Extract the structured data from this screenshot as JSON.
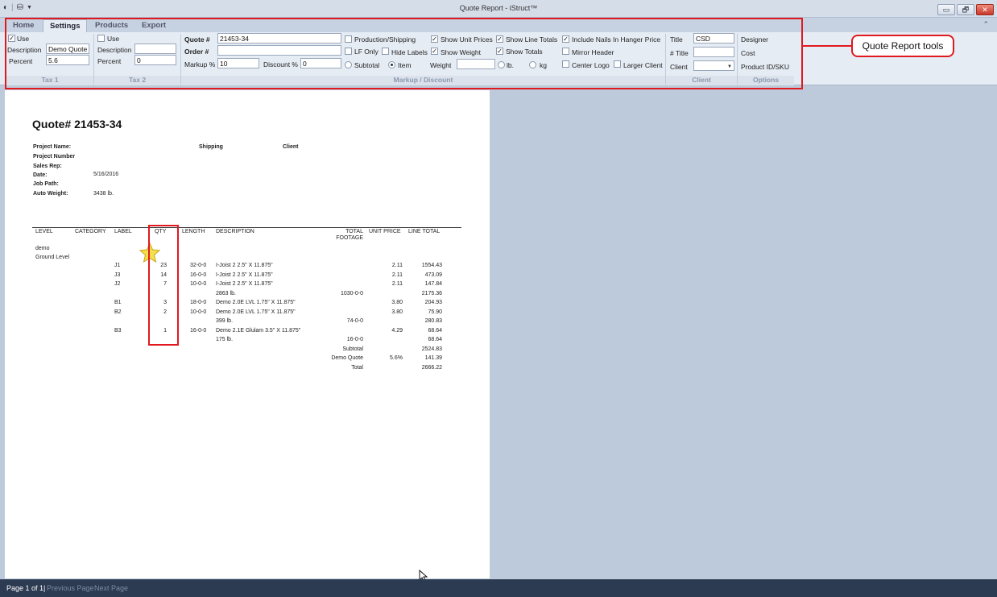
{
  "window": {
    "title": "Quote Report - iStruct™",
    "minimize": "▭",
    "restore": "🗗",
    "close": "✕"
  },
  "ribbon_tabs": [
    "Home",
    "Settings",
    "Products",
    "Export"
  ],
  "tax1": {
    "use_checked": true,
    "use_label": "Use",
    "description_label": "Description",
    "description_value": "Demo Quote",
    "percent_label": "Percent",
    "percent_value": "5.6",
    "group": "Tax 1"
  },
  "tax2": {
    "use_checked": false,
    "use_label": "Use",
    "description_label": "Description",
    "description_value": "",
    "percent_label": "Percent",
    "percent_value": "0",
    "group": "Tax 2"
  },
  "markup": {
    "quote_label": "Quote #",
    "quote_value": "21453-34",
    "order_label": "Order #",
    "order_value": "",
    "markup_label": "Markup %",
    "markup_value": "10",
    "discount_label": "Discount %",
    "discount_value": "0",
    "production_shipping": "Production/Shipping",
    "lf_only": "LF Only",
    "hide_labels": "Hide Labels",
    "subtotal": "Subtotal",
    "item": "Item",
    "weight_label": "Weight",
    "lb": "lb.",
    "kg": "kg",
    "show_unit_prices": "Show Unit Prices",
    "show_weight": "Show Weight",
    "show_line_totals": "Show Line Totals",
    "show_totals": "Show Totals",
    "include_nails": "Include Nails In Hanger Price",
    "mirror_header": "Mirror Header",
    "center_logo": "Center Logo",
    "larger_client": "Larger Client",
    "group": "Markup / Discount"
  },
  "client": {
    "title_label": "Title",
    "title_value": "CSD",
    "ntitle_label": "# Title",
    "ntitle_value": "",
    "client_label": "Client",
    "client_value": "",
    "group": "Client"
  },
  "options": {
    "items": [
      "Designer",
      "Cost",
      "Product ID/SKU"
    ],
    "group": "Options"
  },
  "annotation": {
    "callout": "Quote Report tools"
  },
  "report": {
    "heading": "Quote# 21453-34",
    "project_name_label": "Project Name:",
    "project_number_label": "Project Number",
    "sales_rep_label": "Sales Rep:",
    "date_label": "Date:",
    "date_value": "5/16/2016",
    "job_path_label": "Job Path:",
    "auto_weight_label": "Auto Weight:",
    "auto_weight_value": "3438 lb.",
    "shipping_label": "Shipping",
    "client_label": "Client",
    "columns": {
      "level": "LEVEL",
      "category": "CATEGORY",
      "label": "LABEL",
      "qty": "QTY",
      "length": "LENGTH",
      "description": "DESCRIPTION",
      "total_footage_1": "TOTAL",
      "total_footage_2": "FOOTAGE",
      "unit_price": "UNIT PRICE",
      "line_total": "LINE TOTAL"
    },
    "level_demo": "demo",
    "level_ground": "Ground Level",
    "rows": [
      {
        "label": "J1",
        "qty": "23",
        "length": "32-0-0",
        "desc": "I-Joist 2 2.5\" X 11.875\"",
        "footage": "",
        "unit": "2.11",
        "total": "1554.43"
      },
      {
        "label": "J3",
        "qty": "14",
        "length": "16-0-0",
        "desc": "I-Joist 2 2.5\" X 11.875\"",
        "footage": "",
        "unit": "2.11",
        "total": "473.09"
      },
      {
        "label": "J2",
        "qty": "7",
        "length": "10-0-0",
        "desc": "I-Joist 2 2.5\" X 11.875\"",
        "footage": "",
        "unit": "2.11",
        "total": "147.84"
      },
      {
        "label": "",
        "qty": "",
        "length": "",
        "desc": "2863 lb.",
        "footage": "1030-0-0",
        "unit": "",
        "total": "2175.36"
      },
      {
        "label": "B1",
        "qty": "3",
        "length": "18-0-0",
        "desc": "Demo 2.0E LVL 1.75\" X 11.875\"",
        "footage": "",
        "unit": "3.80",
        "total": "204.93"
      },
      {
        "label": "B2",
        "qty": "2",
        "length": "10-0-0",
        "desc": "Demo 2.0E LVL 1.75\" X 11.875\"",
        "footage": "",
        "unit": "3.80",
        "total": "75.90"
      },
      {
        "label": "",
        "qty": "",
        "length": "",
        "desc": "399 lb.",
        "footage": "74-0-0",
        "unit": "",
        "total": "280.83"
      },
      {
        "label": "B3",
        "qty": "1",
        "length": "16-0-0",
        "desc": "Demo 2.1E Glulam 3.5\" X 11.875\"",
        "footage": "",
        "unit": "4.29",
        "total": "68.64"
      },
      {
        "label": "",
        "qty": "",
        "length": "",
        "desc": "175 lb.",
        "footage": "16-0-0",
        "unit": "",
        "total": "68.64"
      },
      {
        "label": "",
        "qty": "",
        "length": "",
        "desc": "",
        "footage": "Subtotal",
        "unit": "",
        "total": "2524.83"
      },
      {
        "label": "",
        "qty": "",
        "length": "",
        "desc": "",
        "footage": "Demo Quote",
        "unit": "5.6%",
        "total": "141.39"
      },
      {
        "label": "",
        "qty": "",
        "length": "",
        "desc": "",
        "footage": "Total",
        "unit": "",
        "total": "2666.22"
      }
    ]
  },
  "status": {
    "page": "Page 1 of 1|",
    "previous": "Previous Page",
    "next": "Next Page"
  },
  "icons": [
    "app-orb-icon",
    "save-icon",
    "dropdown-arrow-icon",
    "star-icon",
    "cursor-icon"
  ],
  "colors": {
    "highlight": "#e0191f",
    "statusbar": "#2c3a52",
    "workspace": "#bccadb"
  }
}
